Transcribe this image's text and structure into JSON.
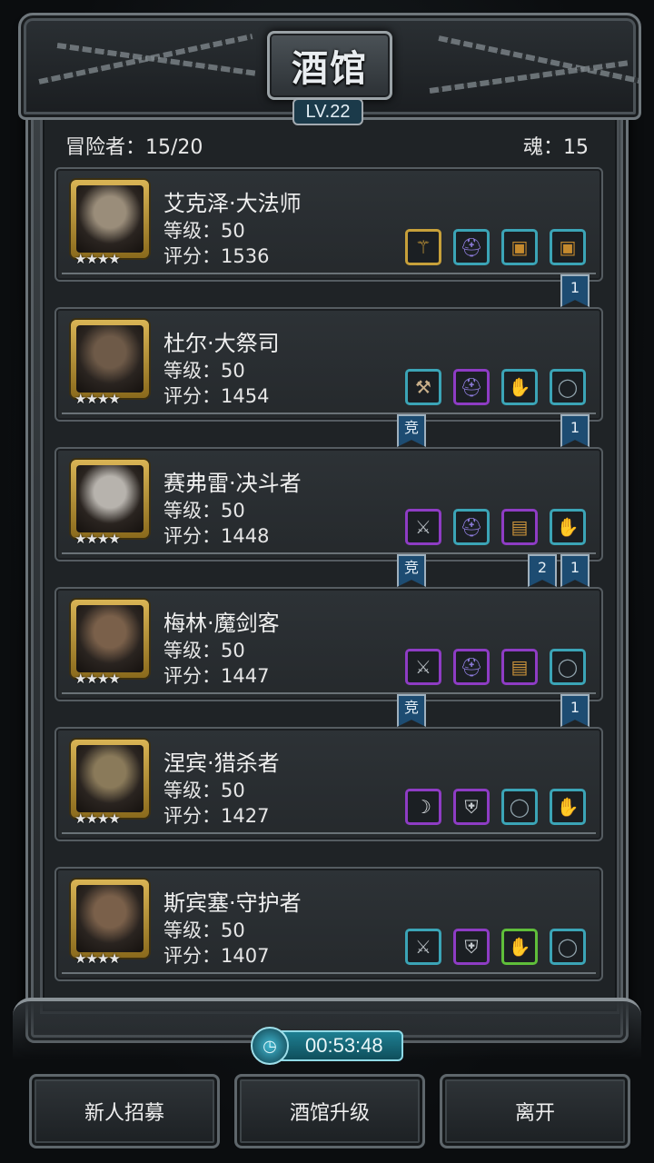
{
  "header": {
    "title": "酒馆",
    "level": "LV.22",
    "adventurers_label": "冒险者：15/20",
    "soul_label": "魂：15"
  },
  "heroes": [
    {
      "name": "艾克泽·大法师",
      "level_label": "等级：50",
      "score_label": "评分：1536",
      "stars": "★★★★",
      "equipment": [
        {
          "icon": "staff-icon",
          "quality": "gold"
        },
        {
          "icon": "helmet-icon",
          "quality": "blue"
        },
        {
          "icon": "chest-icon",
          "quality": "blue"
        },
        {
          "icon": "chest-icon",
          "quality": "blue"
        }
      ],
      "ribbons": [
        "1"
      ]
    },
    {
      "name": "杜尔·大祭司",
      "level_label": "等级：50",
      "score_label": "评分：1454",
      "stars": "★★★★",
      "equipment": [
        {
          "icon": "hammer-icon",
          "quality": "blue"
        },
        {
          "icon": "helmet-icon",
          "quality": "purple"
        },
        {
          "icon": "gauntlet-icon",
          "quality": "blue"
        },
        {
          "icon": "ring-icon",
          "quality": "blue"
        }
      ],
      "ribbons": [
        "竞",
        "1"
      ]
    },
    {
      "name": "赛弗雷·决斗者",
      "level_label": "等级：50",
      "score_label": "评分：1448",
      "stars": "★★★★",
      "equipment": [
        {
          "icon": "sword-icon",
          "quality": "purple"
        },
        {
          "icon": "helmet-icon",
          "quality": "blue"
        },
        {
          "icon": "bracer-icon",
          "quality": "purple"
        },
        {
          "icon": "gauntlet-icon",
          "quality": "blue"
        }
      ],
      "ribbons": [
        "竞",
        "2",
        "1"
      ]
    },
    {
      "name": "梅林·魔剑客",
      "level_label": "等级：50",
      "score_label": "评分：1447",
      "stars": "★★★★",
      "equipment": [
        {
          "icon": "sword-icon",
          "quality": "purple"
        },
        {
          "icon": "helmet-icon",
          "quality": "purple"
        },
        {
          "icon": "bracer-icon",
          "quality": "purple"
        },
        {
          "icon": "ring-icon",
          "quality": "blue"
        }
      ],
      "ribbons": [
        "竞",
        "1"
      ]
    },
    {
      "name": "涅宾·猎杀者",
      "level_label": "等级：50",
      "score_label": "评分：1427",
      "stars": "★★★★",
      "equipment": [
        {
          "icon": "blade-icon",
          "quality": "purple"
        },
        {
          "icon": "armor-icon",
          "quality": "purple"
        },
        {
          "icon": "ring-icon",
          "quality": "blue"
        },
        {
          "icon": "gauntlet-icon",
          "quality": "blue"
        }
      ],
      "ribbons": []
    },
    {
      "name": "斯宾塞·守护者",
      "level_label": "等级：50",
      "score_label": "评分：1407",
      "stars": "★★★★",
      "equipment": [
        {
          "icon": "sword-icon",
          "quality": "blue"
        },
        {
          "icon": "armor-icon",
          "quality": "purple"
        },
        {
          "icon": "gauntlet-icon",
          "quality": "green"
        },
        {
          "icon": "ring-icon",
          "quality": "blue"
        }
      ],
      "ribbons": []
    }
  ],
  "timer": "00:53:48",
  "buttons": {
    "recruit": "新人招募",
    "upgrade": "酒馆升级",
    "leave": "离开"
  }
}
